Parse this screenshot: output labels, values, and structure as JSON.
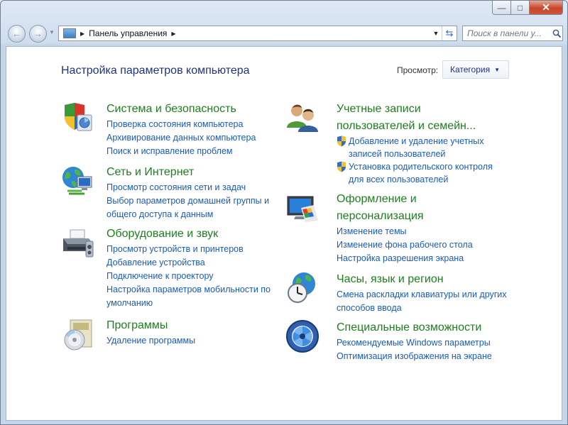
{
  "window": {
    "caption": {
      "minimize": "—",
      "maximize": "□",
      "close": "✕"
    }
  },
  "nav": {
    "back": "←",
    "forward": "→",
    "breadcrumb": "Панель управления",
    "search_placeholder": "Поиск в панели у..."
  },
  "header": {
    "title": "Настройка параметров компьютера",
    "view_label": "Просмотр:",
    "view_value": "Категория"
  },
  "categories": [
    {
      "title": "Система и безопасность",
      "icon": "shield-icon",
      "links": [
        "Проверка состояния компьютера",
        "Архивирование данных компьютера",
        "Поиск и исправление проблем"
      ]
    },
    {
      "title": "Сеть и Интернет",
      "icon": "network-globe-icon",
      "links": [
        "Просмотр состояния сети и задач",
        "Выбор параметров домашней группы и",
        "общего доступа к данным"
      ]
    },
    {
      "title": "Оборудование и звук",
      "icon": "printer-icon",
      "links": [
        "Просмотр устройств и принтеров",
        "Добавление устройства",
        "Подключение к проектору",
        "Настройка параметров мобильности по",
        "умолчанию"
      ]
    },
    {
      "title": "Программы",
      "icon": "programs-disc-icon",
      "links": [
        "Удаление программы"
      ]
    },
    {
      "title_lines": [
        "Учетные записи",
        "пользователей и семейн..."
      ],
      "icon": "users-icon",
      "links": [
        [
          "Добавление и удаление учетных",
          "записей пользователей"
        ],
        [
          "Установка родительского контроля",
          "для всех пользователей"
        ]
      ]
    },
    {
      "title_lines": [
        "Оформление и",
        "персонализация"
      ],
      "icon": "monitor-palette-icon",
      "links": [
        "Изменение темы",
        "Изменение фона рабочего стола",
        "Настройка разрешения экрана"
      ]
    },
    {
      "title": "Часы, язык и регион",
      "icon": "clock-globe-icon",
      "links": [
        "Смена раскладки клавиатуры или других",
        "способов ввода"
      ]
    },
    {
      "title": "Специальные возможности",
      "icon": "accessibility-icon",
      "links": [
        "Рекомендуемые Windows параметры",
        "Оптимизация изображения на экране"
      ]
    }
  ]
}
